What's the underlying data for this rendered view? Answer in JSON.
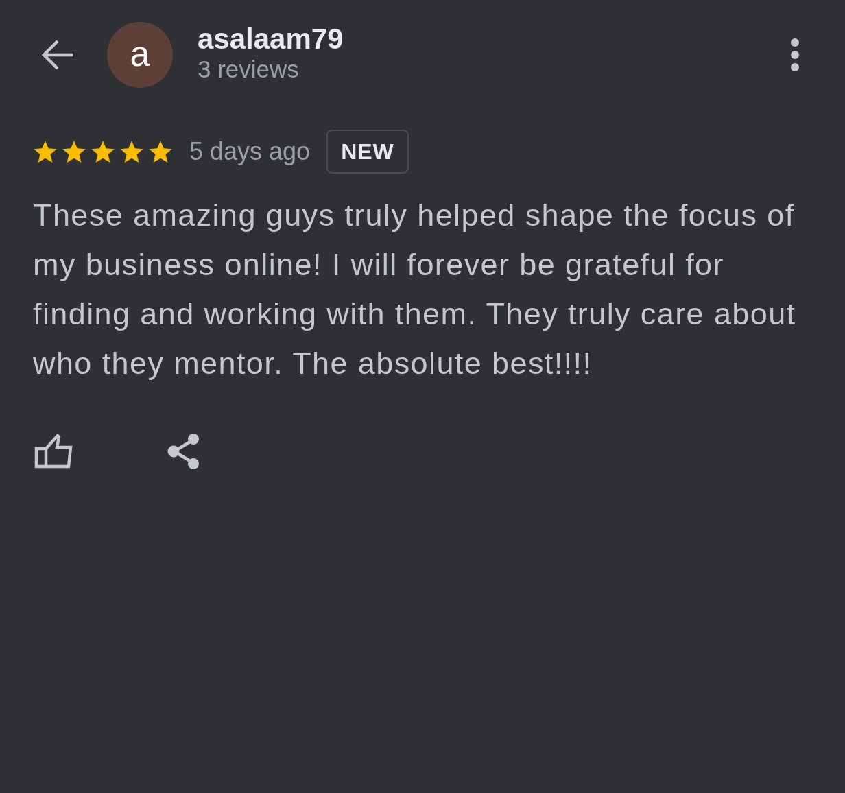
{
  "header": {
    "avatar": "a",
    "name": "asalaam79",
    "subtitle": "3 reviews"
  },
  "review": {
    "stars": 5,
    "time": "5 days ago",
    "badge": "NEW",
    "text": "These amazing guys truly helped shape the focus of my business online! I will forever be grateful for finding and working with them. They truly care about who they mentor. The absolute best!!!!"
  },
  "actions": [
    {
      "kind": "like"
    },
    {
      "kind": "share"
    }
  ]
}
